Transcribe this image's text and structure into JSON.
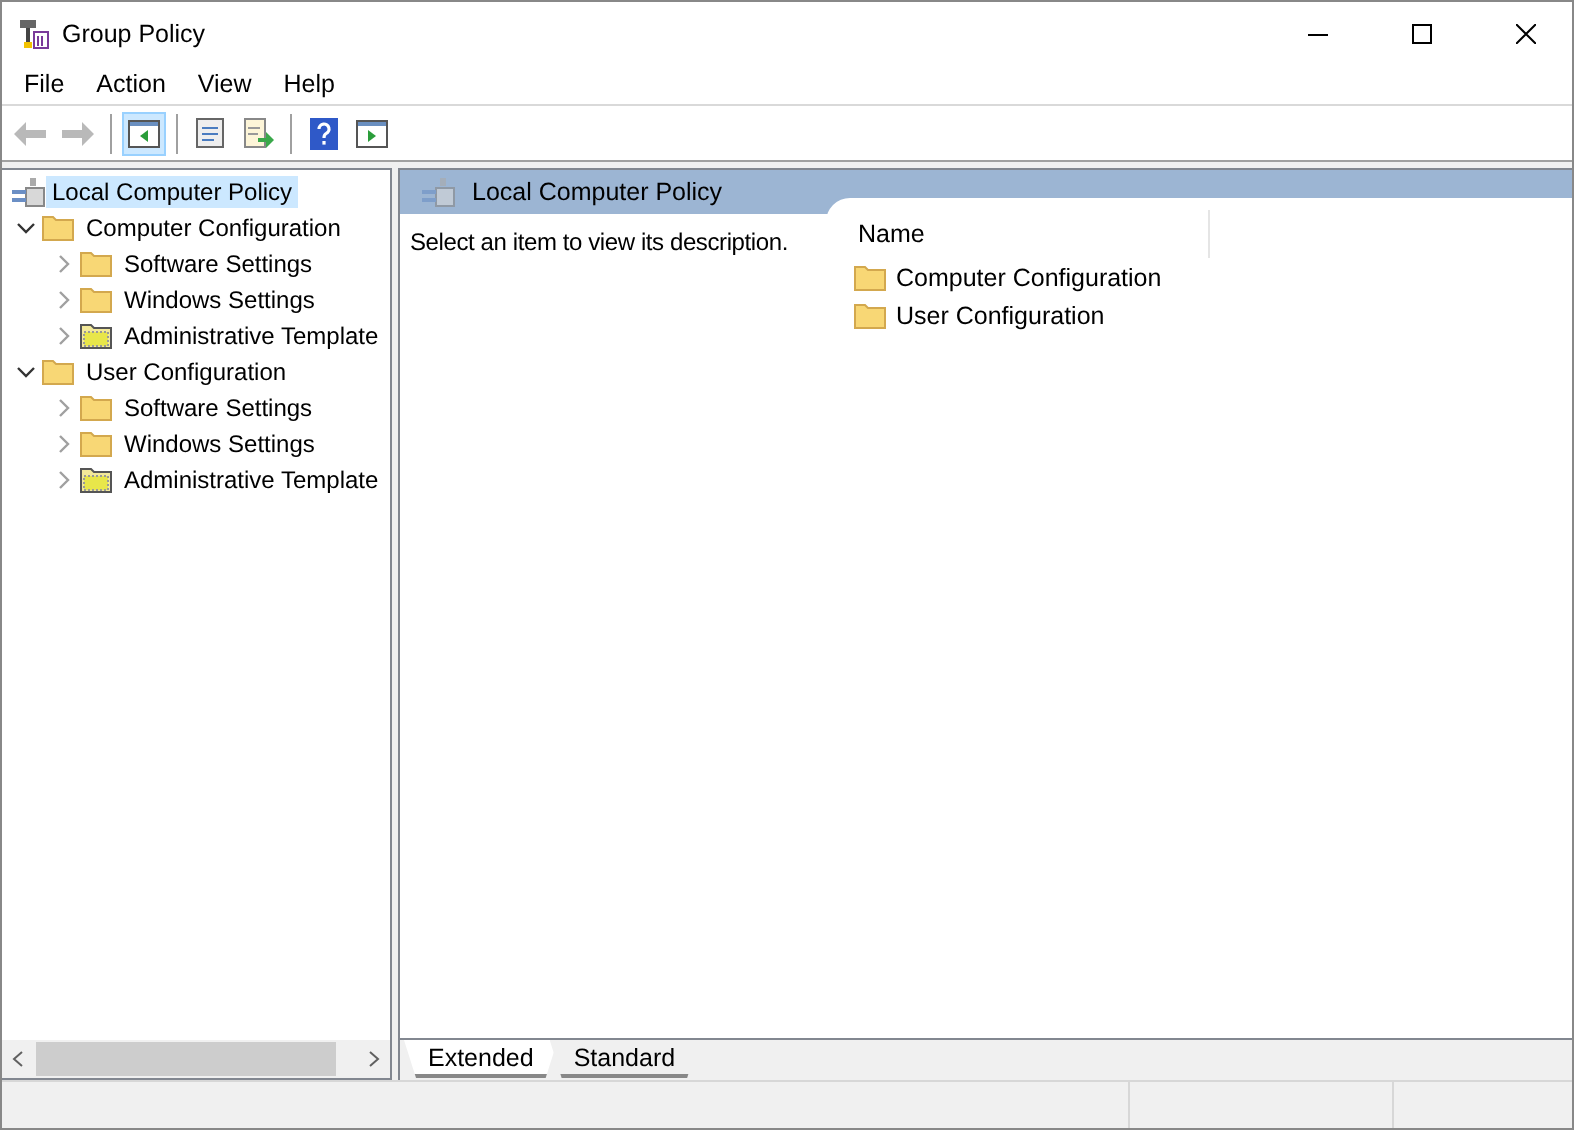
{
  "window": {
    "title": "Group Policy"
  },
  "menu": [
    "File",
    "Action",
    "View",
    "Help"
  ],
  "toolbar": [
    {
      "kind": "back",
      "disabled": true,
      "selected": false
    },
    {
      "kind": "forward",
      "disabled": true,
      "selected": false
    },
    {
      "kind": "tree",
      "disabled": false,
      "selected": true
    },
    {
      "kind": "properties",
      "disabled": false,
      "selected": false
    },
    {
      "kind": "export",
      "disabled": false,
      "selected": false
    },
    {
      "kind": "help",
      "disabled": false,
      "selected": false
    },
    {
      "kind": "actionpane",
      "disabled": false,
      "selected": false
    }
  ],
  "tree": {
    "label": "Local Computer Policy",
    "selected": true,
    "children": [
      {
        "label": "Computer Configuration",
        "kind": "folder",
        "expanded": true,
        "children": [
          {
            "label": "Software Settings",
            "kind": "folder",
            "expanded": false
          },
          {
            "label": "Windows Settings",
            "kind": "folder",
            "expanded": false
          },
          {
            "label": "Administrative Template",
            "kind": "template",
            "expanded": false
          }
        ]
      },
      {
        "label": "User Configuration",
        "kind": "folder",
        "expanded": true,
        "children": [
          {
            "label": "Software Settings",
            "kind": "folder",
            "expanded": false
          },
          {
            "label": "Windows Settings",
            "kind": "folder",
            "expanded": false
          },
          {
            "label": "Administrative Template",
            "kind": "template",
            "expanded": false
          }
        ]
      }
    ]
  },
  "details": {
    "title": "Local Computer Policy",
    "description": "Select an item to view its description.",
    "columns": [
      "Name"
    ],
    "items": [
      "Computer Configuration",
      "User Configuration"
    ]
  },
  "tabs": [
    {
      "label": "Extended",
      "selected": true
    },
    {
      "label": "Standard",
      "selected": false
    }
  ]
}
